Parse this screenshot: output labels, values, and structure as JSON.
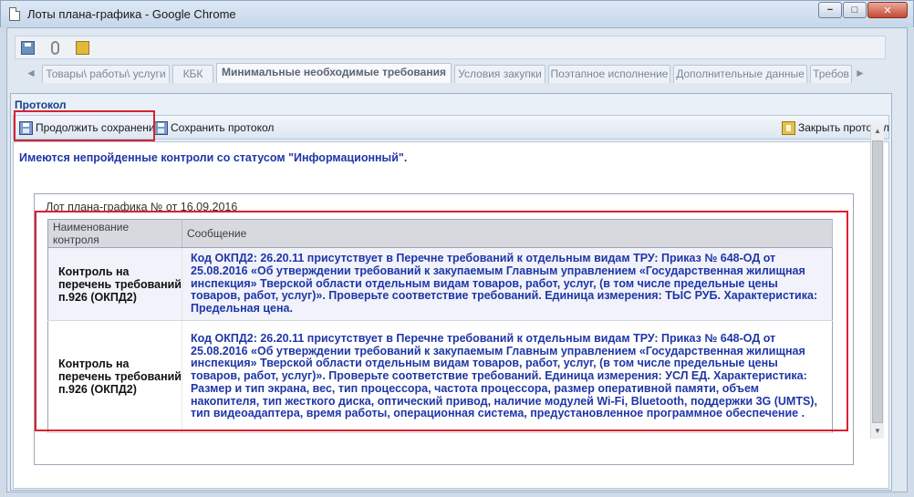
{
  "window": {
    "title": "Лоты плана-графика - Google Chrome",
    "minimize_label": "−",
    "restore_label": "□",
    "close_label": "✕"
  },
  "app": {
    "toolbar_icons": [
      "save-icon",
      "attach-icon",
      "book-icon"
    ],
    "tabs": [
      {
        "label": "Товары\\ работы\\ услуги"
      },
      {
        "label": "КБК"
      },
      {
        "label": "Минимальные необходимые требования",
        "active": true
      },
      {
        "label": "Условия закупки"
      },
      {
        "label": "Поэтапное исполнение"
      },
      {
        "label": "Дополнительные данные"
      },
      {
        "label": "Требов"
      }
    ],
    "tab_prev": "◄",
    "tab_next": "►"
  },
  "protocol": {
    "title": "Протокол",
    "toolbar": {
      "continue_save": "Продолжить сохранение",
      "save_protocol": "Сохранить протокол",
      "close_protocol": "Закрыть протокол"
    },
    "warning": "Имеются непройденные контроли со статусом \"Информационный\".",
    "lot_title": "Лот плана-графика № от 16.09.2016",
    "table": {
      "headers": [
        "Наименование контроля",
        "Сообщение"
      ],
      "rows": [
        {
          "control": "Контроль на перечень требований п.926 (ОКПД2)",
          "message": "Код ОКПД2: 26.20.11 присутствует в Перечне требований к отдельным видам ТРУ: Приказ № 648-ОД от 25.08.2016 «Об утверждении требований к закупаемым Главным управлением «Государственная жилищная инспекция» Тверской области отдельным видам товаров, работ, услуг, (в том числе предельные цены товаров, работ, услуг)». Проверьте соответствие требований. Единица измерения: ТЫС РУБ. Характеристика: Предельная цена."
        },
        {
          "control": "Контроль на перечень требований п.926 (ОКПД2)",
          "message": "Код ОКПД2: 26.20.11 присутствует в Перечне требований к отдельным видам ТРУ: Приказ № 648-ОД от 25.08.2016 «Об утверждении требований к закупаемым Главным управлением «Государственная жилищная инспекция» Тверской области отдельным видам товаров, работ, услуг, (в том числе предельные цены товаров, работ, услуг)». Проверьте соответствие требований. Единица измерения: УСЛ ЕД. Характеристика: Размер и тип экрана, вес, тип процессора, частота процессора, размер оперативной памяти, объем накопителя, тип жесткого диска, оптический привод, наличие модулей Wi-Fi, Bluetooth, поддержки 3G (UMTS), тип видеоадаптера, время работы, операционная система, предустановленное программное обеспечение ."
        }
      ]
    }
  },
  "colors": {
    "highlight": "#d8222e",
    "message_text": "#1f36a7",
    "title_blue": "#15428b"
  }
}
